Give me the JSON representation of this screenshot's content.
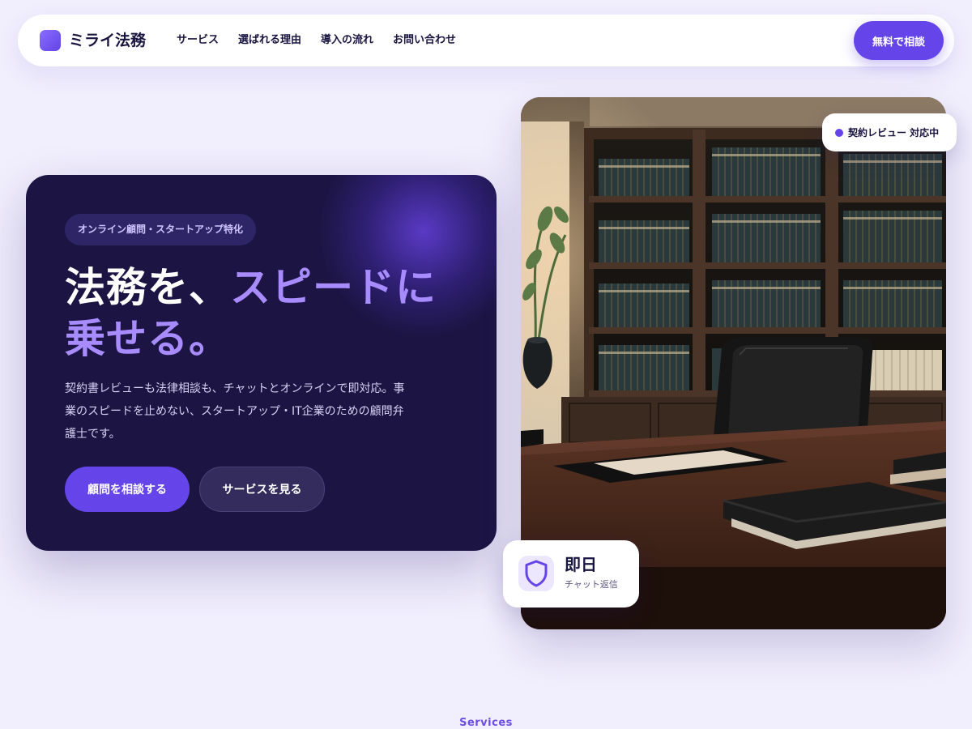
{
  "brand": {
    "name": "ミライ法務",
    "accent_color": "#6544ea"
  },
  "nav": {
    "items": [
      {
        "label": "サービス"
      },
      {
        "label": "選ばれる理由"
      },
      {
        "label": "導入の流れ"
      },
      {
        "label": "お問い合わせ"
      }
    ],
    "cta_label": "無料で相談"
  },
  "hero": {
    "badge": "オンライン顧問・スタートアップ特化",
    "headline_part1": "法務を、",
    "headline_accent": "スピードに",
    "headline_part2": "乗せる。",
    "lead": "契約書レビューも法律相談も、チャットとオンラインで即対応。事業のスピードを止めない、スタートアップ・IT企業のための顧問弁護士です。",
    "primary_button": "顧問を相談する",
    "secondary_button": "サービスを見る"
  },
  "status_chip": {
    "label": "契約レビュー 対応中",
    "icon": "status-dot"
  },
  "response_chip": {
    "value": "即日",
    "caption": "チャット返信",
    "icon": "shield-icon"
  },
  "section": {
    "label": "Services"
  }
}
